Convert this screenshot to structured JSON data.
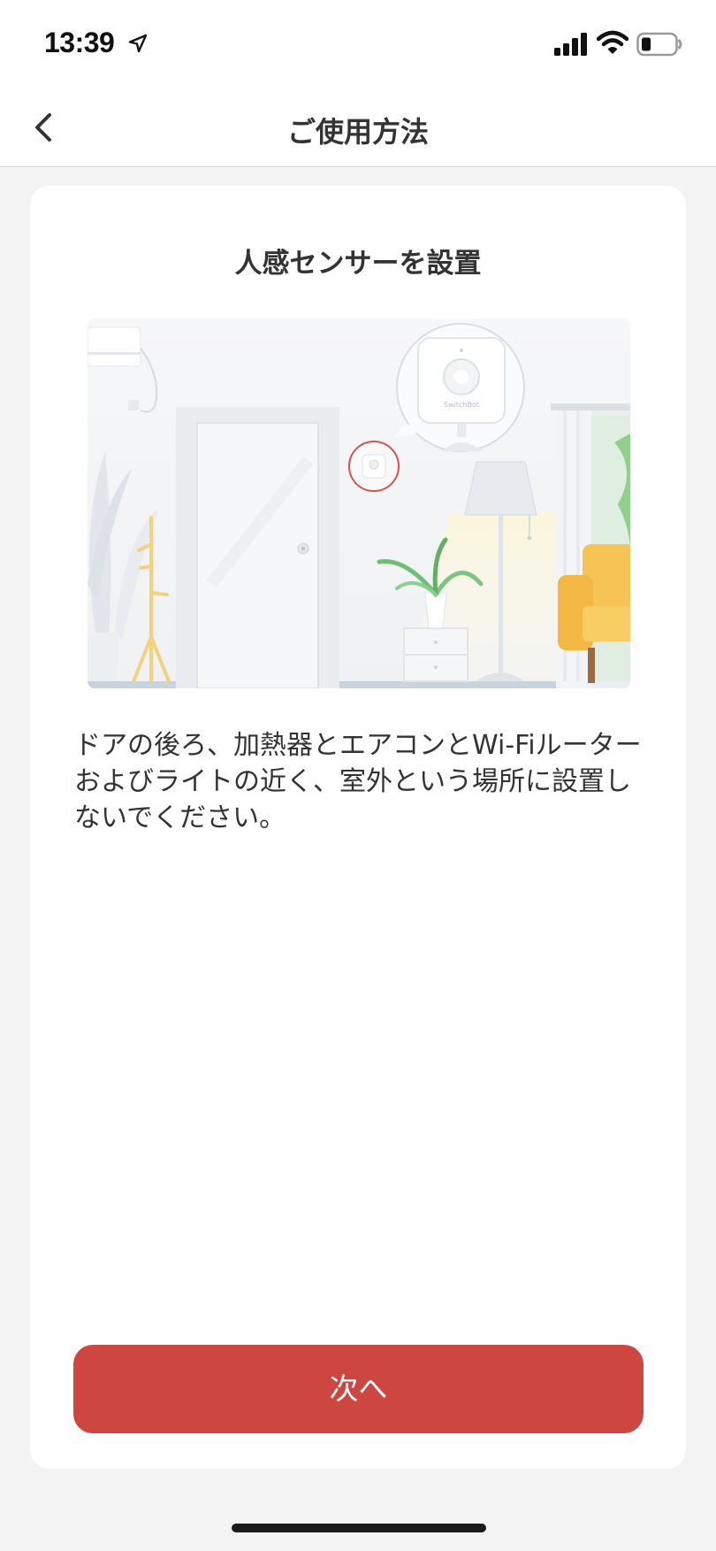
{
  "status": {
    "time": "13:39",
    "icons": [
      "location-arrow-icon",
      "cellular-signal-icon",
      "wifi-icon",
      "battery-icon"
    ]
  },
  "nav": {
    "title": "ご使用方法",
    "back_icon": "chevron-left-icon"
  },
  "card": {
    "title": "人感センサーを設置",
    "illustration": {
      "device_label": "SwitchBot"
    },
    "description": "ドアの後ろ、加熱器とエアコンとWi-Fiルーターおよびライトの近く、室外という場所に設置しないでください。",
    "next_button": "次へ"
  },
  "colors": {
    "accent": "#cd4740",
    "background": "#f3f3f3",
    "card": "#ffffff",
    "text": "#333333"
  }
}
